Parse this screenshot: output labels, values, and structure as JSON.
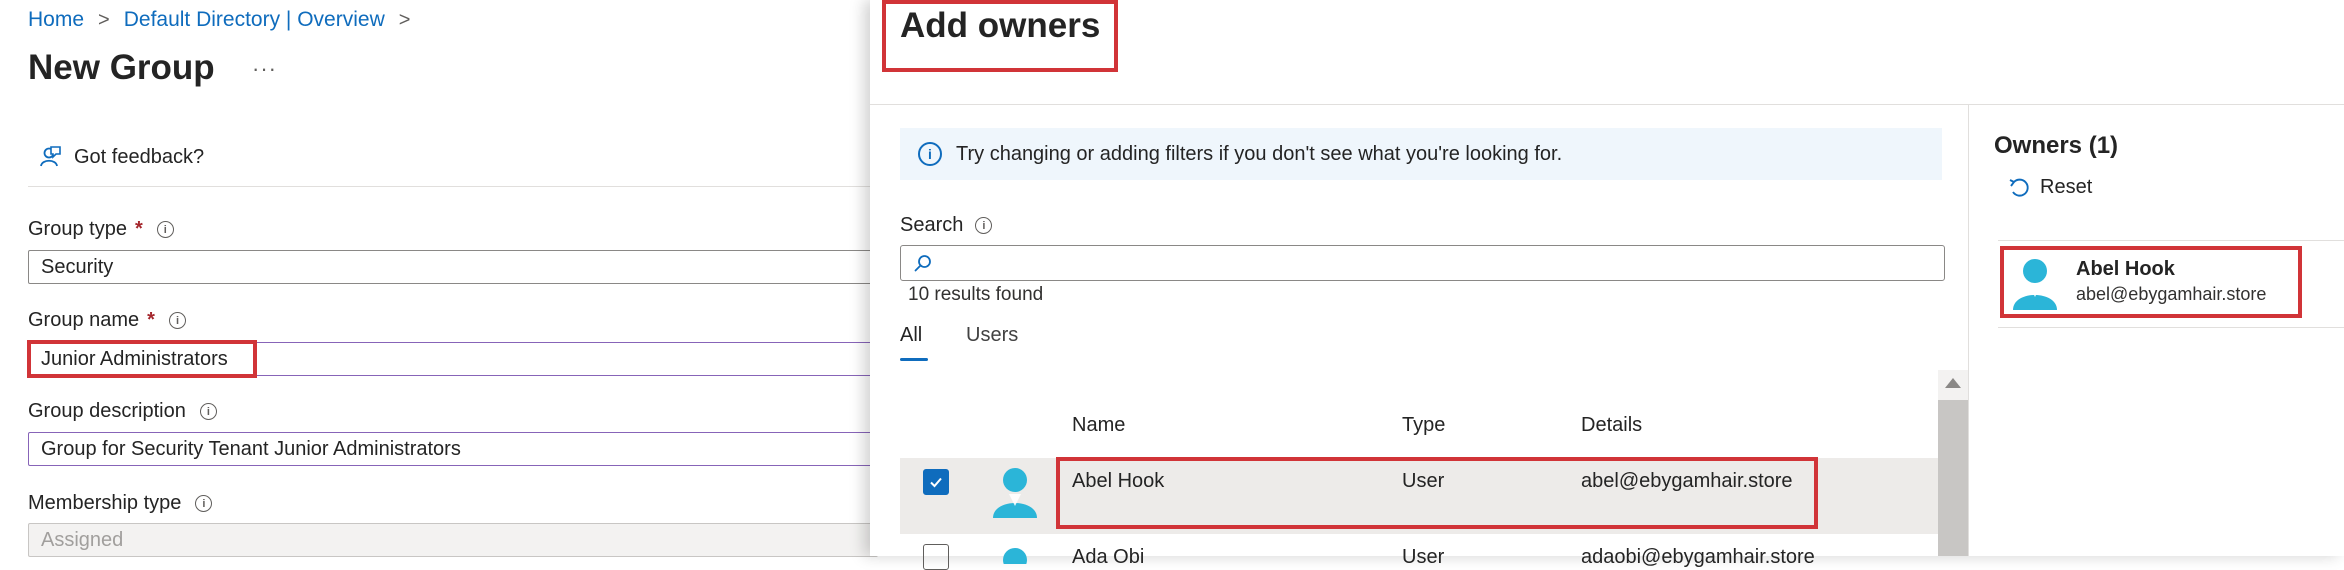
{
  "breadcrumb": {
    "home": "Home",
    "directory": "Default Directory | Overview",
    "sep": ">"
  },
  "page": {
    "title": "New Group",
    "more": "···",
    "feedback": "Got feedback?"
  },
  "form": {
    "group_type": {
      "label": "Group type",
      "required": "*",
      "value": "Security"
    },
    "group_name": {
      "label": "Group name",
      "required": "*",
      "value": "Junior Administrators"
    },
    "group_description": {
      "label": "Group description",
      "value": "Group for Security Tenant Junior Administrators"
    },
    "membership_type": {
      "label": "Membership type",
      "value": "Assigned"
    }
  },
  "blade": {
    "title": "Add owners",
    "info": "Try changing or adding filters if you don't see what you're looking for.",
    "search_label": "Search",
    "results": "10 results found",
    "tabs": [
      "All",
      "Users"
    ],
    "columns": [
      "Name",
      "Type",
      "Details"
    ],
    "rows": [
      {
        "name": "Abel Hook",
        "type": "User",
        "details": "abel@ebygamhair.store",
        "selected": true
      },
      {
        "name": "Ada Obi",
        "type": "User",
        "details": "adaobi@ebygamhair.store",
        "selected": false
      }
    ]
  },
  "owners": {
    "title": "Owners (1)",
    "reset": "Reset",
    "list": [
      {
        "name": "Abel Hook",
        "email": "abel@ebygamhair.store"
      }
    ]
  },
  "colors": {
    "accent": "#0f6cbd",
    "highlight": "#d13438",
    "avatar": "#2bb5d8"
  }
}
